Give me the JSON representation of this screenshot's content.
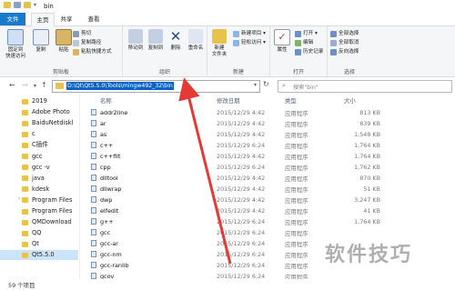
{
  "window": {
    "title": "bin"
  },
  "tabs": {
    "file": "文件",
    "home": "主页",
    "share": "共享",
    "view": "查看"
  },
  "ribbon": {
    "clipboard": {
      "title": "剪贴板",
      "pin": "固定到\n快速访问",
      "copy": "复制",
      "paste": "粘贴",
      "cut": "剪切",
      "copy_path": "复制路径",
      "paste_shortcut": "粘贴快捷方式"
    },
    "organize": {
      "title": "组织",
      "move_to": "移动到",
      "copy_to": "复制到",
      "delete": "删除",
      "rename": "重命名"
    },
    "new": {
      "title": "新建",
      "new_folder": "新建\n文件夹",
      "new_item": "新建项目 ▾",
      "easy_access": "轻松访问 ▾"
    },
    "open": {
      "title": "打开",
      "properties": "属性",
      "open": "打开 ▾",
      "edit": "编辑",
      "history": "历史记录"
    },
    "select": {
      "title": "选择",
      "select_all": "全部选择",
      "select_none": "全部取消",
      "invert": "反向选择"
    }
  },
  "addressbar": {
    "path": "D:\\Qt\\Qt5.5.0\\Tools\\mingw492_32\\bin",
    "search_placeholder": "搜索\"bin\""
  },
  "sidebar": {
    "items": [
      "2019",
      "Adobe Photo",
      "BaiduNetdiskl",
      "c",
      "C插件",
      "gcc",
      "gcc -v",
      "java",
      "kdesk",
      "Program Files",
      "Program Files",
      "QMDownload",
      "QQ",
      "Qt",
      "Qt5.5.0"
    ]
  },
  "columns": {
    "name": "名称",
    "date": "修改日期",
    "type": "类型",
    "size": "大小"
  },
  "files": [
    {
      "name": "addr2line",
      "date": "2015/12/29 4:42",
      "type": "应用程序",
      "size": "813 KB"
    },
    {
      "name": "ar",
      "date": "2015/12/29 4:42",
      "type": "应用程序",
      "size": "839 KB"
    },
    {
      "name": "as",
      "date": "2015/12/29 4:42",
      "type": "应用程序",
      "size": "1,548 KB"
    },
    {
      "name": "c++",
      "date": "2015/12/29 6:24",
      "type": "应用程序",
      "size": "1,764 KB"
    },
    {
      "name": "c++filt",
      "date": "2015/12/29 4:42",
      "type": "应用程序",
      "size": "1,764 KB"
    },
    {
      "name": "cpp",
      "date": "2015/12/29 6:24",
      "type": "应用程序",
      "size": "1,762 KB"
    },
    {
      "name": "dlltool",
      "date": "2015/12/29 4:42",
      "type": "应用程序",
      "size": "870 KB"
    },
    {
      "name": "dllwrap",
      "date": "2015/12/29 4:42",
      "type": "应用程序",
      "size": "51 KB"
    },
    {
      "name": "dwp",
      "date": "2015/12/29 4:42",
      "type": "应用程序",
      "size": "3,247 KB"
    },
    {
      "name": "elfedit",
      "date": "2015/12/29 4:42",
      "type": "应用程序",
      "size": "41 KB"
    },
    {
      "name": "g++",
      "date": "2015/12/29 6:24",
      "type": "应用程序",
      "size": "1,764 KB"
    },
    {
      "name": "gcc",
      "date": "2015/12/29 6:24",
      "type": "应用程序",
      "size": ""
    },
    {
      "name": "gcc-ar",
      "date": "2015/12/29 6:24",
      "type": "应用程序",
      "size": ""
    },
    {
      "name": "gcc-nm",
      "date": "2015/12/29 6:24",
      "type": "应用程序",
      "size": ""
    },
    {
      "name": "gcc-ranlib",
      "date": "2015/12/29 6:24",
      "type": "应用程序",
      "size": ""
    },
    {
      "name": "gcov",
      "date": "2015/12/29 6:24",
      "type": "应用程序",
      "size": ""
    }
  ],
  "status": {
    "count": "59 个项目"
  },
  "watermark": "软件技巧",
  "colors": {
    "accent": "#1979ca",
    "selection": "#cce4f7",
    "arrow": "#e53935"
  }
}
